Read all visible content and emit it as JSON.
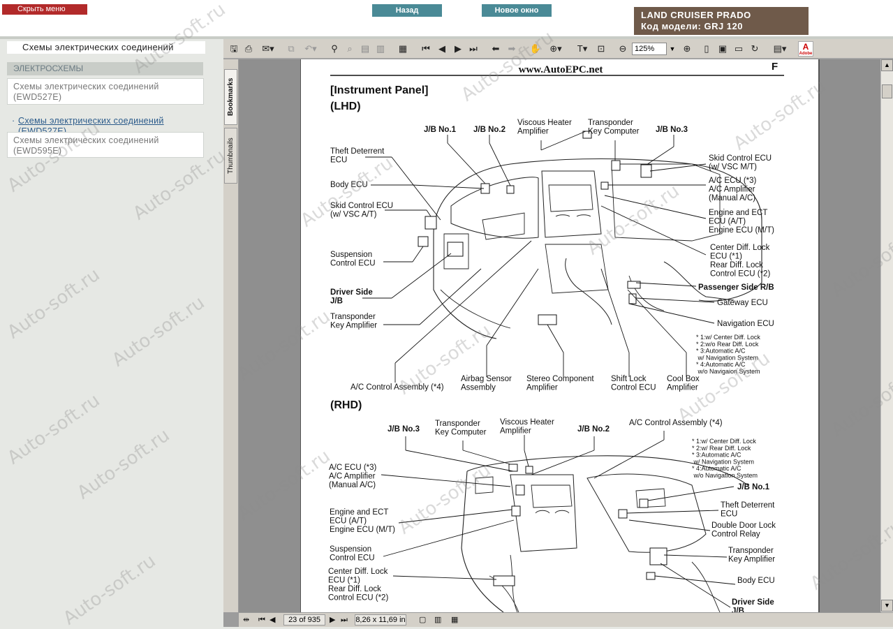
{
  "header": {
    "hide_menu": "Скрыть меню",
    "back": "Назад",
    "new_window": "Новое окно",
    "model_line1": "LAND CRUISER PRADO",
    "model_line2": "Код модели: GRJ 120"
  },
  "sidebar": {
    "title": "Схемы электрических соединений",
    "section": "ЭЛЕКТРОСХЕМЫ",
    "items": [
      {
        "label": "Схемы электрических соединений (EWD527E)"
      },
      {
        "label": "Схемы электрических соединений (EWD527E)"
      },
      {
        "label": "Схемы электрических соединений (EWD595E)"
      }
    ]
  },
  "viewer": {
    "zoom": "125%",
    "tabs": {
      "bookmarks": "Bookmarks",
      "thumbnails": "Thumbnails"
    },
    "status": {
      "page": "23 of 935",
      "size": "8,26 x 11,69 in"
    }
  },
  "document": {
    "site": "www.AutoEPC.net",
    "section_letter": "F",
    "title": "[Instrument Panel]",
    "lhd": "(LHD)",
    "rhd": "(RHD)",
    "lhd_labels": {
      "jb1": "J/B No.1",
      "jb2": "J/B No.2",
      "viscous": "Viscous Heater\nAmplifier",
      "transponder_computer": "Transponder\nKey Computer",
      "jb3": "J/B No.3",
      "theft": "Theft Deterrent\nECU",
      "body": "Body ECU",
      "skid_left": "Skid Control ECU\n(w/ VSC A/T)",
      "suspension": "Suspension\nControl ECU",
      "driver_jb": "Driver Side\nJ/B",
      "transponder_amp": "Transponder\nKey Amplifier",
      "ac_assembly": "A/C Control Assembly (*4)",
      "airbag": "Airbag Sensor\nAssembly",
      "stereo": "Stereo Component\nAmplifier",
      "shift": "Shift Lock\nControl ECU",
      "coolbox": "Cool Box\nAmplifier",
      "skid_right": "Skid Control ECU\n(w/ VSC M/T)",
      "ac_ecu": "A/C ECU (*3)\nA/C Amplifier\n(Manual A/C)",
      "engine": "Engine and ECT\nECU (A/T)\nEngine ECU (M/T)",
      "center_diff": "Center Diff. Lock\nECU (*1)\nRear Diff. Lock\nControl ECU (*2)",
      "passenger_rb": "Passenger Side R/B",
      "gateway": "Gateway ECU",
      "navigation": "Navigation ECU",
      "notes": "* 1:w/ Center Diff. Lock\n* 2:w/o Rear Diff. Lock\n* 3:Automatic A/C\n   w/ Navigation System\n* 4:Automatic A/C\n   w/o Navigaion System"
    },
    "rhd_labels": {
      "jb3": "J/B No.3",
      "transponder_computer": "Transponder\nKey Computer",
      "viscous": "Viscous Heater\nAmplifier",
      "jb2": "J/B No.2",
      "ac_assembly": "A/C Control Assembly (*4)",
      "notes": "* 1:w/ Center Diff. Lock\n* 2:w/ Rear Diff. Lock\n* 3:Automatic A/C\n   w/ Navigation System\n* 4:Automatic A/C\n   w/o Navigation System",
      "ac_ecu": "A/C ECU (*3)\nA/C Amplifier\n(Manual A/C)",
      "jb1": "J/B No.1",
      "engine": "Engine and ECT\nECU (A/T)\nEngine ECU (M/T)",
      "theft": "Theft Deterrent\nECU",
      "double_door": "Double Door Lock\nControl Relay",
      "suspension": "Suspension\nControl ECU",
      "transponder_amp": "Transponder\nKey Amplifier",
      "center_diff": "Center Diff. Lock\nECU (*1)\nRear Diff. Lock\nControl ECU (*2)",
      "body": "Body ECU",
      "driver_jb": "Driver Side\nJ/B"
    }
  },
  "watermark": "Auto-soft.ru"
}
